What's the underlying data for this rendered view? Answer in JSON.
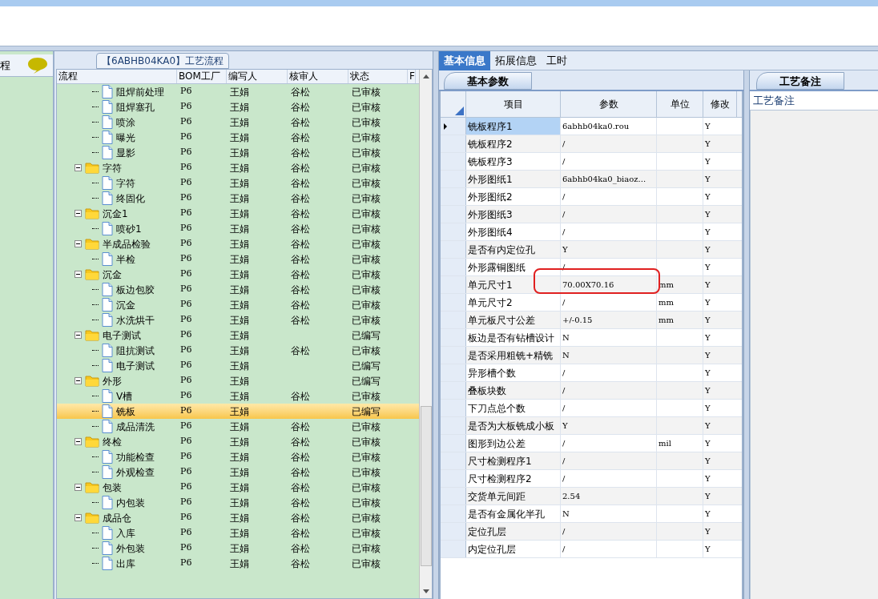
{
  "left_panel": {
    "label": "程"
  },
  "flow_panel": {
    "title": "【6ABHB04KA0】工艺流程",
    "columns": [
      "流程",
      "BOM工厂",
      "编写人",
      "核审人",
      "状态",
      "F"
    ],
    "rows": [
      {
        "kind": "step",
        "name": "阻焊前处理",
        "factory": "P6",
        "writer": "王娟",
        "reviewer": "谷松",
        "status": "已审核",
        "selected": false
      },
      {
        "kind": "step",
        "name": "阻焊塞孔",
        "factory": "P6",
        "writer": "王娟",
        "reviewer": "谷松",
        "status": "已审核",
        "selected": false
      },
      {
        "kind": "step",
        "name": "喷涂",
        "factory": "P6",
        "writer": "王娟",
        "reviewer": "谷松",
        "status": "已审核",
        "selected": false
      },
      {
        "kind": "step",
        "name": "曝光",
        "factory": "P6",
        "writer": "王娟",
        "reviewer": "谷松",
        "status": "已审核",
        "selected": false
      },
      {
        "kind": "step",
        "name": "显影",
        "factory": "P6",
        "writer": "王娟",
        "reviewer": "谷松",
        "status": "已审核",
        "selected": false
      },
      {
        "kind": "group",
        "name": "字符",
        "factory": "P6",
        "writer": "王娟",
        "reviewer": "谷松",
        "status": "已审核",
        "selected": false,
        "expanded": true,
        "children": [
          {
            "kind": "step",
            "name": "字符",
            "factory": "P6",
            "writer": "王娟",
            "reviewer": "谷松",
            "status": "已审核",
            "selected": false
          },
          {
            "kind": "step",
            "name": "终固化",
            "factory": "P6",
            "writer": "王娟",
            "reviewer": "谷松",
            "status": "已审核",
            "selected": false
          }
        ]
      },
      {
        "kind": "group",
        "name": "沉金1",
        "factory": "P6",
        "writer": "王娟",
        "reviewer": "谷松",
        "status": "已审核",
        "selected": false,
        "expanded": true,
        "children": [
          {
            "kind": "step",
            "name": "喷砂1",
            "factory": "P6",
            "writer": "王娟",
            "reviewer": "谷松",
            "status": "已审核",
            "selected": false
          }
        ]
      },
      {
        "kind": "group",
        "name": "半成品检验",
        "factory": "P6",
        "writer": "王娟",
        "reviewer": "谷松",
        "status": "已审核",
        "selected": false,
        "expanded": true,
        "children": [
          {
            "kind": "step",
            "name": "半检",
            "factory": "P6",
            "writer": "王娟",
            "reviewer": "谷松",
            "status": "已审核",
            "selected": false
          }
        ]
      },
      {
        "kind": "group",
        "name": "沉金",
        "factory": "P6",
        "writer": "王娟",
        "reviewer": "谷松",
        "status": "已审核",
        "selected": false,
        "expanded": true,
        "children": [
          {
            "kind": "step",
            "name": "板边包胶",
            "factory": "P6",
            "writer": "王娟",
            "reviewer": "谷松",
            "status": "已审核",
            "selected": false
          },
          {
            "kind": "step",
            "name": "沉金",
            "factory": "P6",
            "writer": "王娟",
            "reviewer": "谷松",
            "status": "已审核",
            "selected": false
          },
          {
            "kind": "step",
            "name": "水洗烘干",
            "factory": "P6",
            "writer": "王娟",
            "reviewer": "谷松",
            "status": "已审核",
            "selected": false
          }
        ]
      },
      {
        "kind": "group",
        "name": "电子测试",
        "factory": "P6",
        "writer": "王娟",
        "status": "已编写",
        "selected": false,
        "expanded": true,
        "children": [
          {
            "kind": "step",
            "name": "阻抗测试",
            "factory": "P6",
            "writer": "王娟",
            "reviewer": "谷松",
            "status": "已审核",
            "selected": false
          },
          {
            "kind": "step",
            "name": "电子测试",
            "factory": "P6",
            "writer": "王娟",
            "status": "已编写",
            "selected": false
          }
        ]
      },
      {
        "kind": "group",
        "name": "外形",
        "factory": "P6",
        "writer": "王娟",
        "status": "已编写",
        "selected": false,
        "expanded": true,
        "children": [
          {
            "kind": "step",
            "name": "V槽",
            "factory": "P6",
            "writer": "王娟",
            "reviewer": "谷松",
            "status": "已审核",
            "selected": false
          },
          {
            "kind": "step",
            "name": "铣板",
            "factory": "P6",
            "writer": "王娟",
            "status": "已编写",
            "selected": true
          },
          {
            "kind": "step",
            "name": "成品清洗",
            "factory": "P6",
            "writer": "王娟",
            "reviewer": "谷松",
            "status": "已审核",
            "selected": false
          }
        ]
      },
      {
        "kind": "group",
        "name": "终检",
        "factory": "P6",
        "writer": "王娟",
        "reviewer": "谷松",
        "status": "已审核",
        "selected": false,
        "expanded": true,
        "children": [
          {
            "kind": "step",
            "name": "功能检查",
            "factory": "P6",
            "writer": "王娟",
            "reviewer": "谷松",
            "status": "已审核",
            "selected": false
          },
          {
            "kind": "step",
            "name": "外观检查",
            "factory": "P6",
            "writer": "王娟",
            "reviewer": "谷松",
            "status": "已审核",
            "selected": false
          }
        ]
      },
      {
        "kind": "group",
        "name": "包装",
        "factory": "P6",
        "writer": "王娟",
        "reviewer": "谷松",
        "status": "已审核",
        "selected": false,
        "expanded": true,
        "children": [
          {
            "kind": "step",
            "name": "内包装",
            "factory": "P6",
            "writer": "王娟",
            "reviewer": "谷松",
            "status": "已审核",
            "selected": false
          }
        ]
      },
      {
        "kind": "group",
        "name": "成品仓",
        "factory": "P6",
        "writer": "王娟",
        "reviewer": "谷松",
        "status": "已审核",
        "selected": false,
        "expanded": true,
        "children": [
          {
            "kind": "step",
            "name": "入库",
            "factory": "P6",
            "writer": "王娟",
            "reviewer": "谷松",
            "status": "已审核",
            "selected": false
          },
          {
            "kind": "step",
            "name": "外包装",
            "factory": "P6",
            "writer": "王娟",
            "reviewer": "谷松",
            "status": "已审核",
            "selected": false
          },
          {
            "kind": "step",
            "name": "出库",
            "factory": "P6",
            "writer": "王娟",
            "reviewer": "谷松",
            "status": "已审核",
            "selected": false
          }
        ]
      }
    ]
  },
  "tabs": [
    {
      "label": "基本信息",
      "selected": true
    },
    {
      "label": "拓展信息",
      "selected": false
    },
    {
      "label": "工时",
      "selected": false
    }
  ],
  "params_panel": {
    "tab": "基本参数",
    "columns": [
      "项目",
      "参数",
      "单位",
      "修改"
    ],
    "rows": [
      {
        "item": "铣板程序1",
        "value": "6abhb04ka0.rou",
        "modified": "Y",
        "selected": true
      },
      {
        "item": "铣板程序2",
        "value": "/",
        "modified": "Y",
        "selected": false
      },
      {
        "item": "铣板程序3",
        "value": "/",
        "modified": "Y",
        "selected": false
      },
      {
        "item": "外形图纸1",
        "value": "6abhb04ka0_biaoz...",
        "modified": "Y",
        "selected": false
      },
      {
        "item": "外形图纸2",
        "value": "/",
        "modified": "Y",
        "selected": false
      },
      {
        "item": "外形图纸3",
        "value": "/",
        "modified": "Y",
        "selected": false
      },
      {
        "item": "外形图纸4",
        "value": "/",
        "modified": "Y",
        "selected": false
      },
      {
        "item": "是否有内定位孔",
        "value": "Y",
        "modified": "Y",
        "selected": false
      },
      {
        "item": "外形露铜图纸",
        "value": "/",
        "modified": "Y",
        "selected": false
      },
      {
        "item": "单元尺寸1",
        "value": "70.00X70.16",
        "unit": "mm",
        "modified": "Y",
        "selected": false,
        "highlighted": true
      },
      {
        "item": "单元尺寸2",
        "value": "/",
        "unit": "mm",
        "modified": "Y",
        "selected": false
      },
      {
        "item": "单元板尺寸公差",
        "value": "+/-0.15",
        "unit": "mm",
        "modified": "Y",
        "selected": false
      },
      {
        "item": "板边是否有钻槽设计",
        "value": "N",
        "modified": "Y",
        "selected": false
      },
      {
        "item": "是否采用粗铣+精铣",
        "value": "N",
        "modified": "Y",
        "selected": false
      },
      {
        "item": "异形槽个数",
        "value": "/",
        "modified": "Y",
        "selected": false
      },
      {
        "item": "叠板块数",
        "value": "/",
        "modified": "Y",
        "selected": false
      },
      {
        "item": "下刀点总个数",
        "value": "/",
        "modified": "Y",
        "selected": false
      },
      {
        "item": "是否为大板铣成小板",
        "value": "Y",
        "modified": "Y",
        "selected": false
      },
      {
        "item": "图形到边公差",
        "value": "/",
        "unit": "mil",
        "modified": "Y",
        "selected": false
      },
      {
        "item": "尺寸检测程序1",
        "value": "/",
        "modified": "Y",
        "selected": false
      },
      {
        "item": "尺寸检测程序2",
        "value": "/",
        "modified": "Y",
        "selected": false
      },
      {
        "item": "交货单元间距",
        "value": "2.54",
        "modified": "Y",
        "selected": false
      },
      {
        "item": "是否有金属化半孔",
        "value": "N",
        "modified": "Y",
        "selected": false
      },
      {
        "item": "定位孔层",
        "value": "/",
        "modified": "Y",
        "selected": false
      },
      {
        "item": "内定位孔层",
        "value": "/",
        "modified": "Y",
        "selected": false
      }
    ]
  },
  "notes_panel": {
    "tab": "工艺备注",
    "label": "工艺备注"
  }
}
